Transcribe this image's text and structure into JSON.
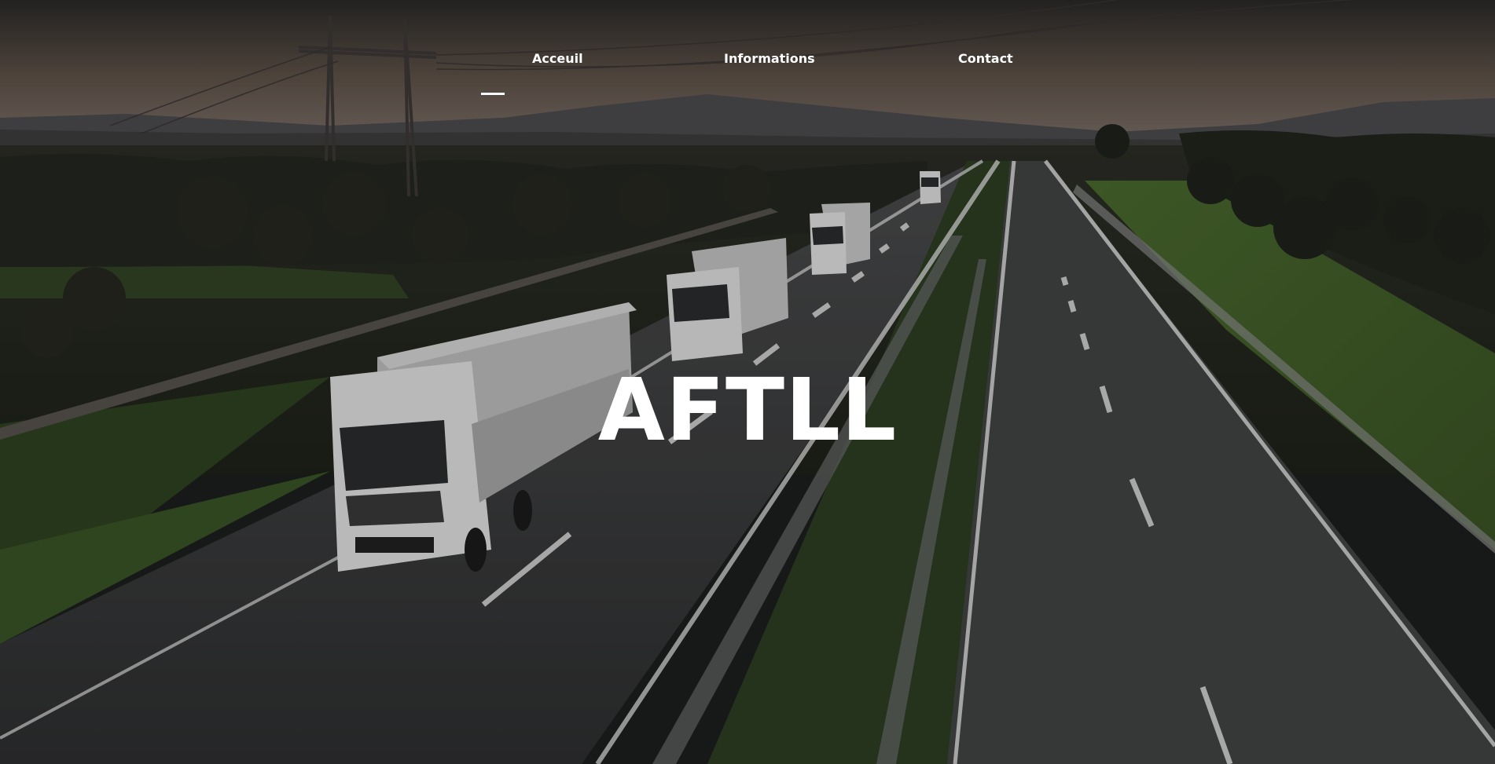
{
  "nav": {
    "items": [
      {
        "label": "Acceuil",
        "active": true
      },
      {
        "label": "Informations",
        "active": false
      },
      {
        "label": "Contact",
        "active": false
      }
    ]
  },
  "hero": {
    "title": "AFTLL",
    "background": "highway-trucks-photo"
  },
  "colors": {
    "text": "#ffffff",
    "sky_dark": "#2b2a2a",
    "sky_warm": "#6e5e52",
    "road": "#3b3c3d",
    "grass": "#3f5a2c"
  }
}
